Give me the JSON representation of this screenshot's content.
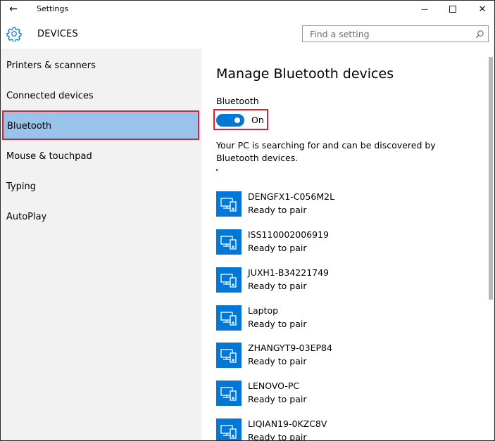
{
  "window": {
    "title": "Settings",
    "back_glyph": "←",
    "minimize_glyph": "—",
    "close_glyph": "✕"
  },
  "header": {
    "section_title": "DEVICES",
    "section_icon": "gear-icon",
    "search_placeholder": "Find a setting",
    "search_icon": "search-icon"
  },
  "sidebar": {
    "items": [
      {
        "label": "Printers & scanners",
        "selected": false
      },
      {
        "label": "Connected devices",
        "selected": false
      },
      {
        "label": "Bluetooth",
        "selected": true
      },
      {
        "label": "Mouse & touchpad",
        "selected": false
      },
      {
        "label": "Typing",
        "selected": false
      },
      {
        "label": "AutoPlay",
        "selected": false
      }
    ]
  },
  "main": {
    "title": "Manage Bluetooth devices",
    "bluetooth_label": "Bluetooth",
    "toggle_state": "On",
    "status_text": "Your PC is searching for and can be discovered by Bluetooth devices.",
    "devices": [
      {
        "name": "DENGFX1-C056M2L",
        "status": "Ready to pair"
      },
      {
        "name": "ISS110002006919",
        "status": "Ready to pair"
      },
      {
        "name": "JUXH1-B34221749",
        "status": "Ready to pair"
      },
      {
        "name": "Laptop",
        "status": "Ready to pair"
      },
      {
        "name": "ZHANGYT9-03EP84",
        "status": "Ready to pair"
      },
      {
        "name": "LENOVO-PC",
        "status": "Ready to pair"
      },
      {
        "name": "LIQIAN19-0KZC8V",
        "status": "Ready to pair"
      }
    ]
  },
  "colors": {
    "accent": "#0078d7",
    "selection": "#99c3ea",
    "highlight_outline": "#e0202d",
    "sidebar_bg": "#f2f2f2"
  }
}
